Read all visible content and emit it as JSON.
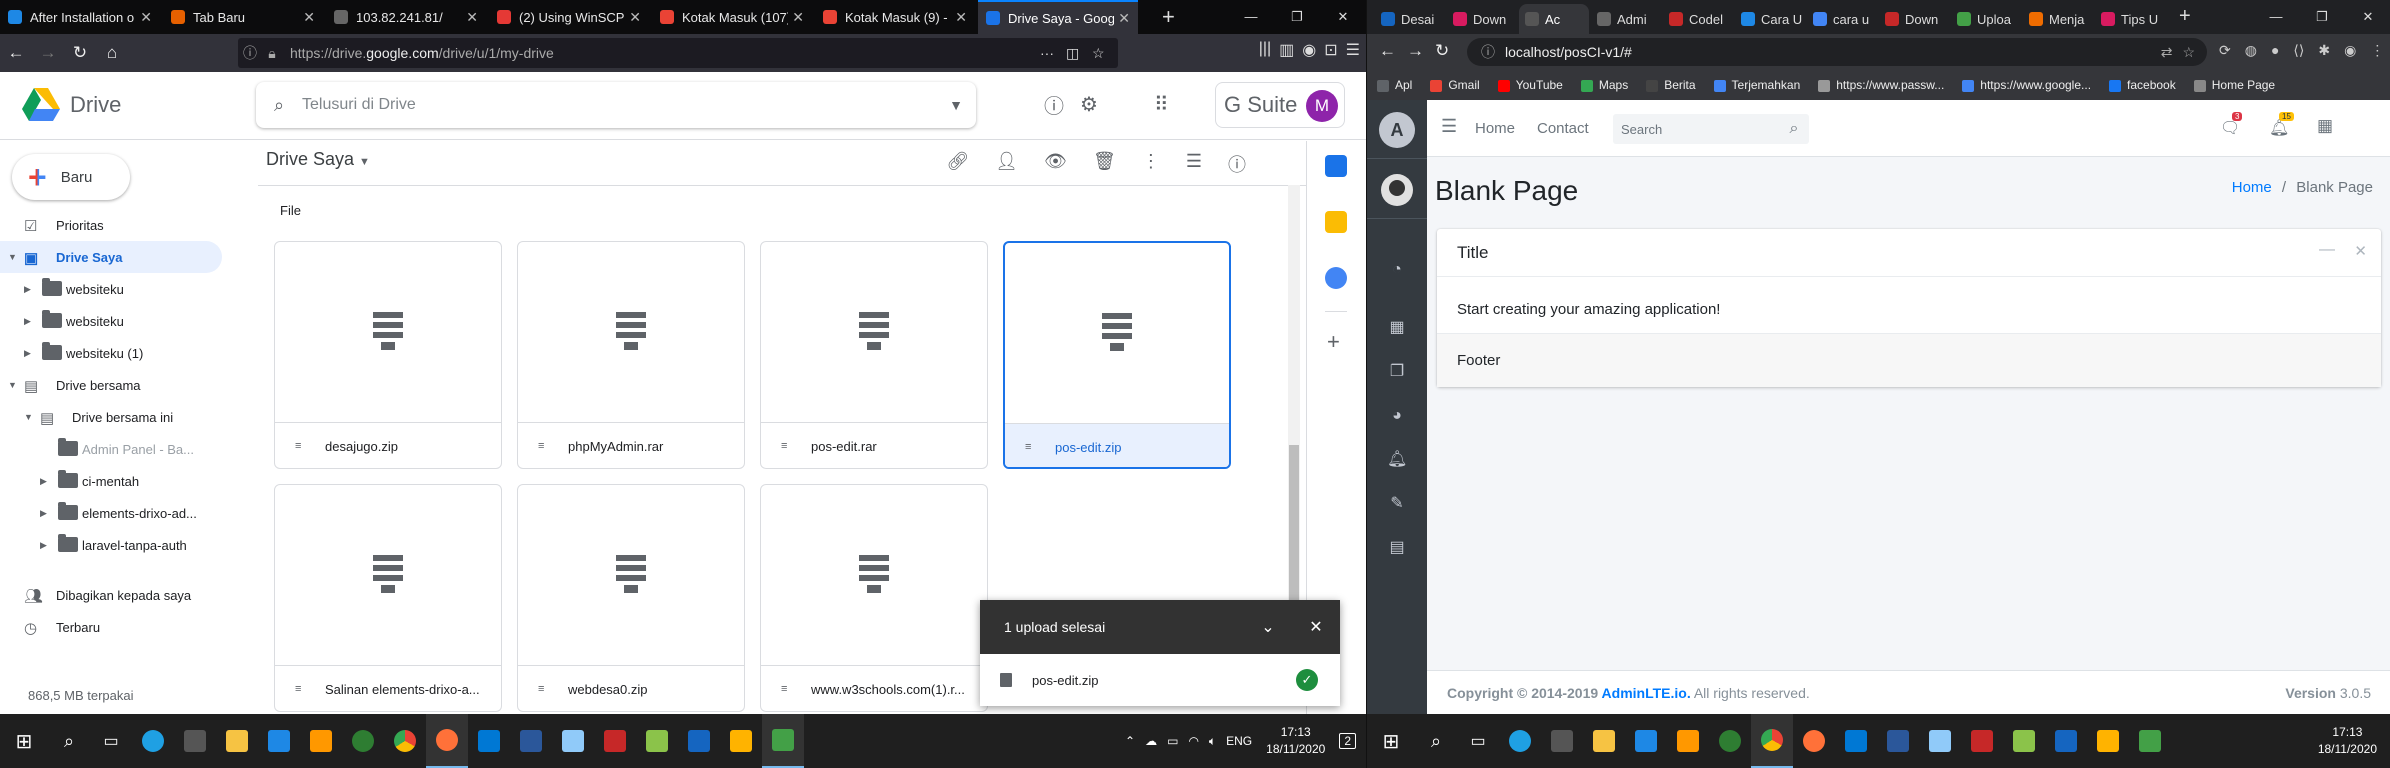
{
  "firefox": {
    "tabs": [
      {
        "label": "After Installation o",
        "color": "#1e88e5",
        "active": false
      },
      {
        "label": "Tab Baru",
        "color": "#e66000",
        "active": false
      },
      {
        "label": "103.82.241.81/",
        "color": "#666666",
        "active": false
      },
      {
        "label": "(2) Using WinSCP to",
        "color": "#e53935",
        "active": false
      },
      {
        "label": "Kotak Masuk (107)",
        "color": "#ea4335",
        "active": false
      },
      {
        "label": "Kotak Masuk (9) - 1",
        "color": "#ea4335",
        "active": false
      },
      {
        "label": "Drive Saya - Google",
        "color": "#1a73e8",
        "active": true
      }
    ],
    "url_prefix": "https://drive.",
    "url_domain": "google.com",
    "url_path": "/drive/u/1/my-drive"
  },
  "drive": {
    "app_name": "Drive",
    "search_placeholder": "Telusuri di Drive",
    "gsuite_label": "G Suite",
    "avatar_letter": "M",
    "new_label": "Baru",
    "sidebar": [
      {
        "label": "Prioritas",
        "indent": 0,
        "caret": "",
        "icon": "check",
        "selected": false
      },
      {
        "label": "Drive Saya",
        "indent": 0,
        "caret": "▼",
        "icon": "drive",
        "selected": true
      },
      {
        "label": "websiteku",
        "indent": 1,
        "caret": "▶",
        "icon": "folder",
        "selected": false
      },
      {
        "label": "websiteku",
        "indent": 1,
        "caret": "▶",
        "icon": "folder",
        "selected": false
      },
      {
        "label": "websiteku (1)",
        "indent": 1,
        "caret": "▶",
        "icon": "folder",
        "selected": false
      },
      {
        "label": "Drive bersama",
        "indent": 0,
        "caret": "▼",
        "icon": "shared",
        "selected": false
      },
      {
        "label": "Drive bersama ini",
        "indent": 1,
        "caret": "▼",
        "icon": "shared",
        "selected": false
      },
      {
        "label": "Admin Panel - Ba...",
        "indent": 2,
        "caret": "",
        "icon": "folder",
        "selected": false
      },
      {
        "label": "ci-mentah",
        "indent": 2,
        "caret": "▶",
        "icon": "folder",
        "selected": false
      },
      {
        "label": "elements-drixo-ad...",
        "indent": 2,
        "caret": "▶",
        "icon": "folder",
        "selected": false
      },
      {
        "label": "laravel-tanpa-auth",
        "indent": 2,
        "caret": "▶",
        "icon": "folder",
        "selected": false
      },
      {
        "label": "",
        "indent": 0,
        "caret": "",
        "icon": "",
        "selected": false
      },
      {
        "label": "Dibagikan kepada saya",
        "indent": 0,
        "caret": "",
        "icon": "people",
        "selected": false
      },
      {
        "label": "Terbaru",
        "indent": 0,
        "caret": "",
        "icon": "clock",
        "selected": false
      }
    ],
    "storage": "868,5 MB terpakai",
    "breadcrumb": "Drive Saya",
    "section_label": "File",
    "files": [
      {
        "name": "desajugo.zip",
        "selected": false
      },
      {
        "name": "phpMyAdmin.rar",
        "selected": false
      },
      {
        "name": "pos-edit.rar",
        "selected": false
      },
      {
        "name": "pos-edit.zip",
        "selected": true
      },
      {
        "name": "Salinan elements-drixo-a...",
        "selected": false
      },
      {
        "name": "webdesa0.zip",
        "selected": false
      },
      {
        "name": "www.w3schools.com(1).r...",
        "selected": false
      }
    ],
    "upload": {
      "title": "1 upload selesai",
      "file": "pos-edit.zip"
    }
  },
  "taskbar_left": {
    "lang": "ENG",
    "time": "17:13",
    "date": "18/11/2020",
    "notif": "2"
  },
  "chrome": {
    "tabs": [
      {
        "label": "Desai",
        "color": "#1565c0"
      },
      {
        "label": "Down",
        "color": "#d81b60"
      },
      {
        "label": "Ac",
        "color": "#555555"
      },
      {
        "label": "Admi",
        "color": "#666666"
      },
      {
        "label": "Codel",
        "color": "#c62828"
      },
      {
        "label": "Cara U",
        "color": "#1e88e5"
      },
      {
        "label": "cara u",
        "color": "#4285f4"
      },
      {
        "label": "Down",
        "color": "#c62828"
      },
      {
        "label": "Uploa",
        "color": "#43a047"
      },
      {
        "label": "Menja",
        "color": "#ef6c00"
      },
      {
        "label": "Tips U",
        "color": "#d81b60"
      }
    ],
    "url": "localhost/posCI-v1/#",
    "bookmarks": [
      "Apl",
      "Gmail",
      "YouTube",
      "Maps",
      "Berita",
      "Terjemahkan",
      "https://www.passw...",
      "https://www.google...",
      "facebook",
      "Home Page"
    ]
  },
  "adminlte": {
    "nav": [
      "Home",
      "Contact"
    ],
    "search_placeholder": "Search",
    "msg_badge": "3",
    "notif_badge": "15",
    "page_title": "Blank Page",
    "breadcrumb_home": "Home",
    "breadcrumb_sep": "/",
    "breadcrumb_current": "Blank Page",
    "card_title": "Title",
    "card_body": "Start creating your amazing application!",
    "card_footer": "Footer",
    "footer_copy": "Copyright © 2014-2019 ",
    "footer_link": "AdminLTE.io.",
    "footer_rights": " All rights reserved.",
    "version_label": "Version",
    "version": "3.0.5"
  },
  "taskbar_right": {
    "time": "17:13",
    "date": "18/11/2020"
  },
  "colors": {
    "drive_blue": "#1a73e8",
    "adminlte_dark": "#343a40",
    "link": "#007bff"
  }
}
